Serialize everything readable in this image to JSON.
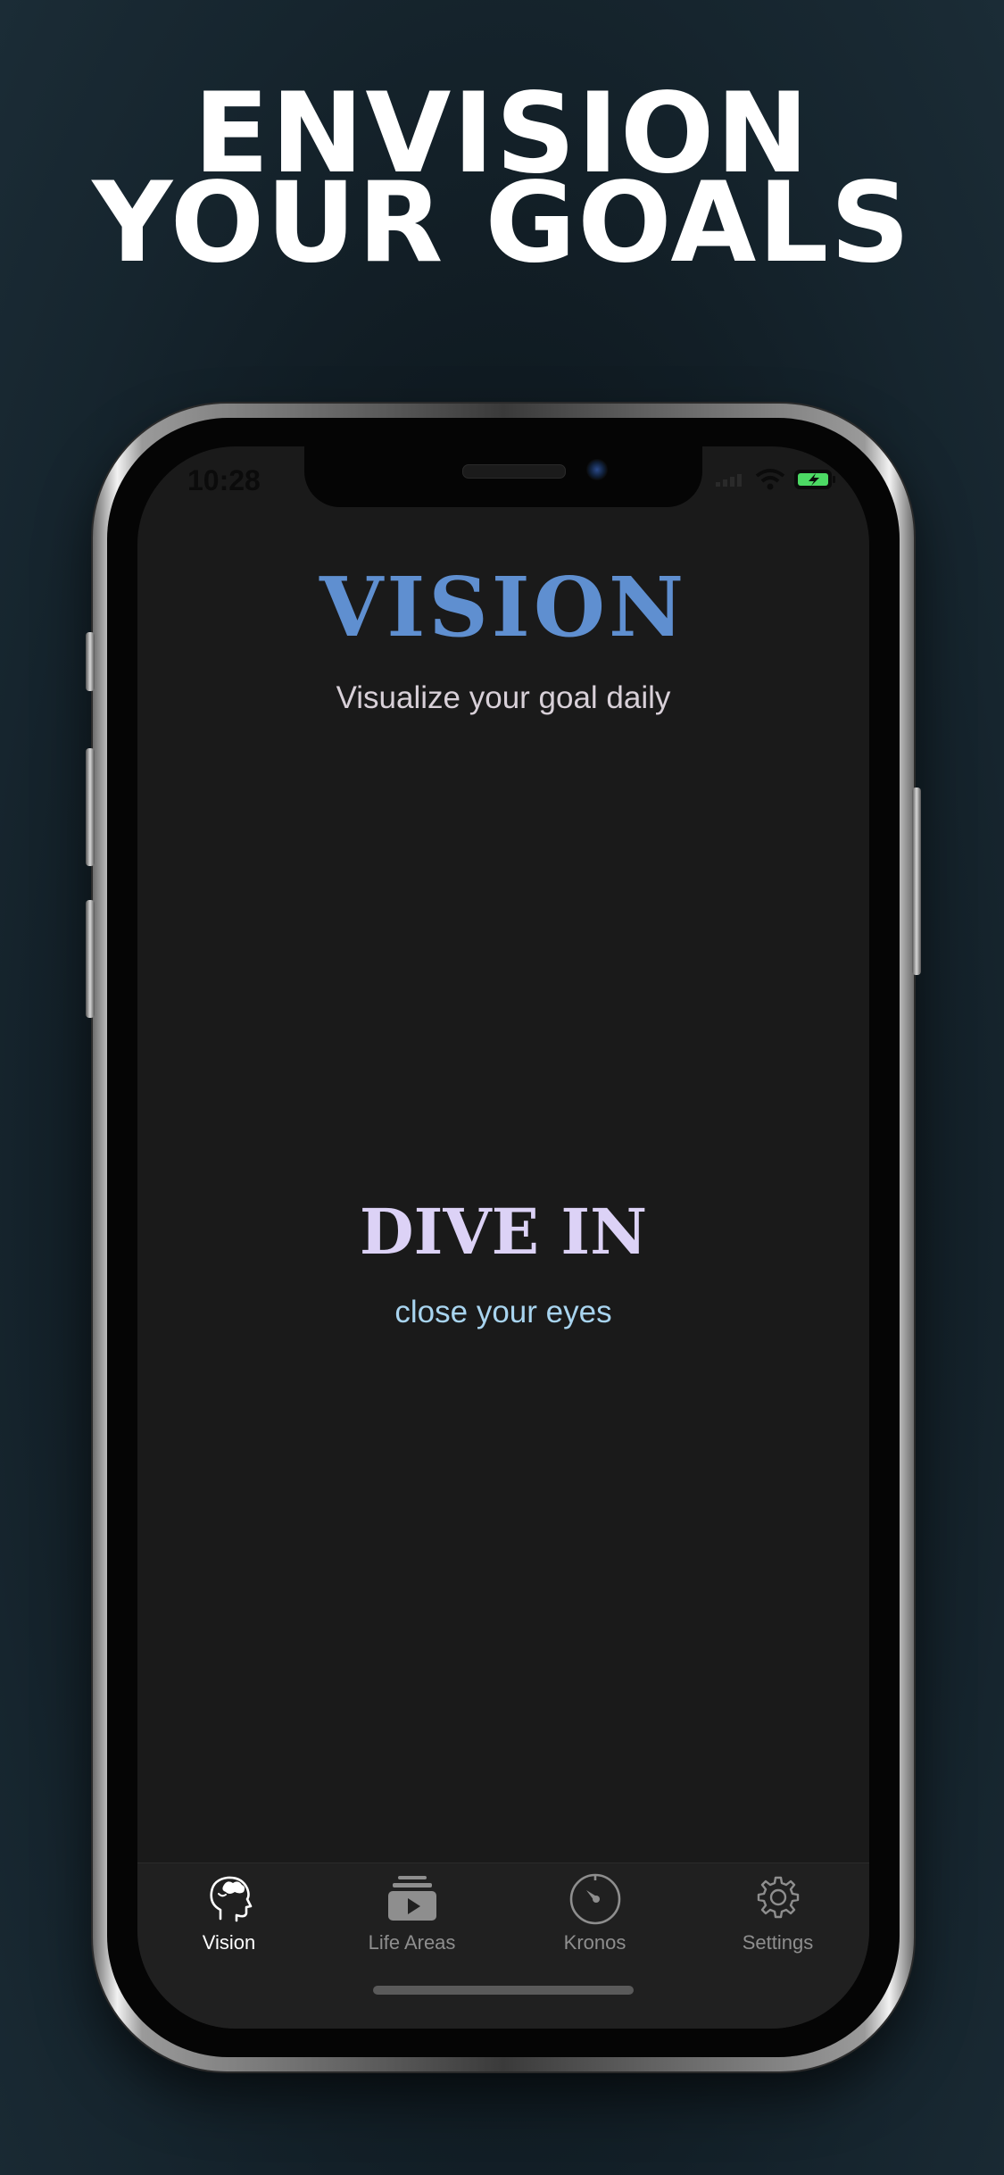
{
  "headline": {
    "line1": "ENVISION",
    "line2": "YOUR GOALS"
  },
  "status_bar": {
    "time": "10:28",
    "icons": [
      "signal-icon",
      "wifi-icon",
      "battery-charging-icon"
    ],
    "battery_color": "#4cd964"
  },
  "main": {
    "title": "VISION",
    "subtitle": "Visualize your goal daily",
    "title_color": "#5f8fd0",
    "dive_title": "DIVE IN",
    "dive_subtitle": "close your eyes"
  },
  "tab_bar": {
    "tabs": [
      {
        "label": "Vision",
        "icon": "head-brain-icon",
        "active": true
      },
      {
        "label": "Life Areas",
        "icon": "video-stack-icon",
        "active": false
      },
      {
        "label": "Kronos",
        "icon": "timer-dial-icon",
        "active": false
      },
      {
        "label": "Settings",
        "icon": "gear-icon",
        "active": false
      }
    ]
  }
}
